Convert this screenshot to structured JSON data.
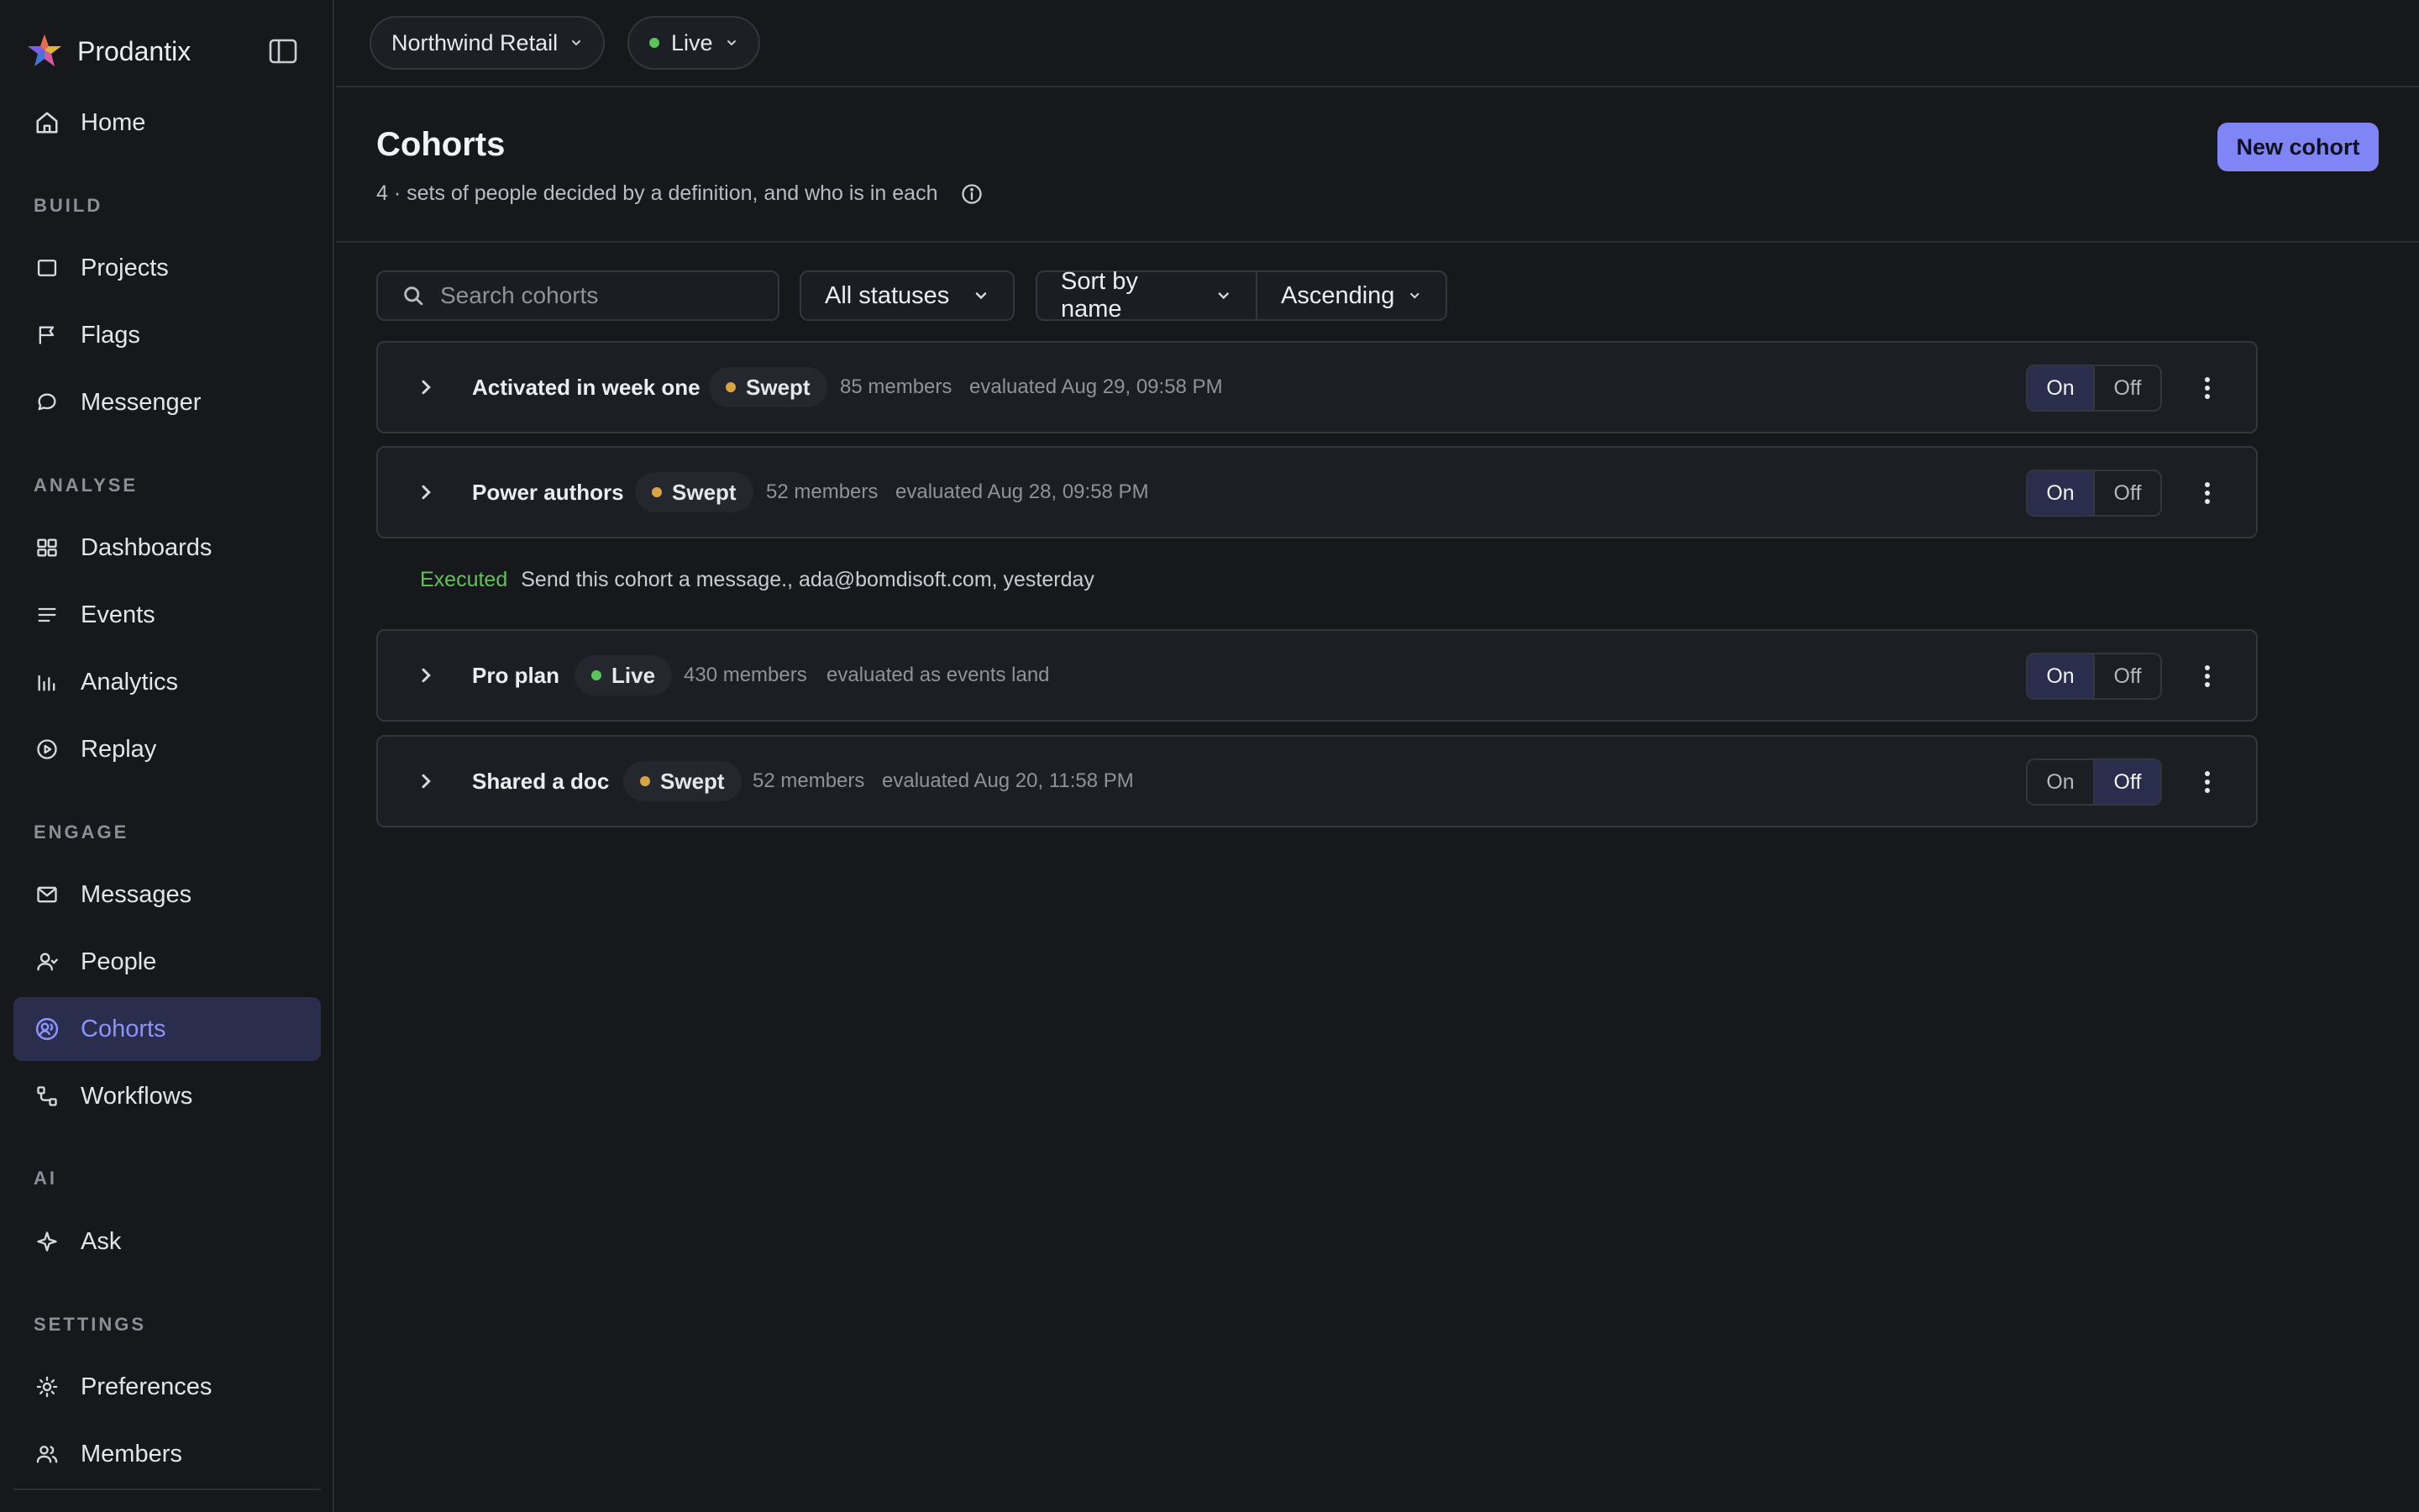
{
  "app": {
    "name": "Prodantix"
  },
  "sidebar": {
    "home": "Home",
    "sections": {
      "build": "BUILD",
      "analyse": "ANALYSE",
      "engage": "ENGAGE",
      "ai": "AI",
      "settings": "SETTINGS"
    },
    "items": {
      "projects": "Projects",
      "flags": "Flags",
      "messenger": "Messenger",
      "dashboards": "Dashboards",
      "events": "Events",
      "analytics": "Analytics",
      "replay": "Replay",
      "messages": "Messages",
      "people": "People",
      "cohorts": "Cohorts",
      "workflows": "Workflows",
      "ask": "Ask",
      "preferences": "Preferences",
      "members": "Members"
    },
    "active": "cohorts"
  },
  "topbar": {
    "workspace": "Northwind Retail",
    "environment": "Live",
    "environment_color": "#5cc25a"
  },
  "header": {
    "title": "Cohorts",
    "subtitle": "4 · sets of people decided by a definition, and who is in each",
    "new_button": "New cohort"
  },
  "toolbar": {
    "search_placeholder": "Search cohorts",
    "status_filter": "All statuses",
    "sort_by": "Sort by name",
    "sort_order": "Ascending"
  },
  "cohorts": [
    {
      "name": "Activated in week one",
      "status": "Swept",
      "status_color": "#d9a441",
      "members": "85 members",
      "evaluated": "evaluated Aug 29, 09:58 PM",
      "on": "On",
      "off": "Off",
      "enabled": true
    },
    {
      "name": "Power authors",
      "status": "Swept",
      "status_color": "#d9a441",
      "members": "52 members",
      "evaluated": "evaluated Aug 28, 09:58 PM",
      "on": "On",
      "off": "Off",
      "enabled": true
    },
    {
      "name": "Pro plan",
      "status": "Live",
      "status_color": "#5cc25a",
      "members": "430 members",
      "evaluated": "evaluated as events land",
      "on": "On",
      "off": "Off",
      "enabled": true
    },
    {
      "name": "Shared a doc",
      "status": "Swept",
      "status_color": "#d9a441",
      "members": "52 members",
      "evaluated": "evaluated Aug 20, 11:58 PM",
      "on": "On",
      "off": "Off",
      "enabled": false
    }
  ],
  "execution_note": {
    "label": "Executed",
    "text": "Send this cohort a message., ada@bomdisoft.com, yesterday",
    "label_color": "#64c15a"
  },
  "colors": {
    "accent": "#7f85f5",
    "active_nav_bg": "#2a2d4c",
    "background": "#16181c"
  }
}
